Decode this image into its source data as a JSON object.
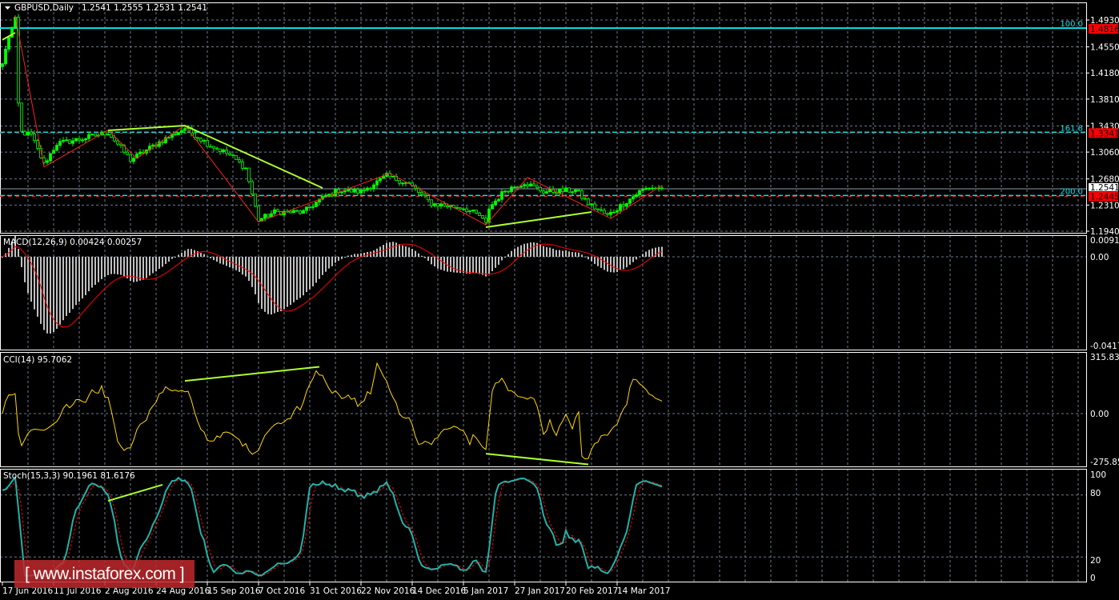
{
  "header": {
    "symbol": "GBPUSD,Daily",
    "ohlc": "1.2541 1.2555 1.2531 1.2541"
  },
  "colors": {
    "bg": "#000000",
    "bull": "#00ff00",
    "fib": "#00e5ee",
    "zigzag": "#ff2020",
    "trend": "#adff2f",
    "macd_hist": "#c0c0c0",
    "signal": "#ff0000",
    "cci": "#ffd700",
    "stoch_main": "#20b2aa",
    "stoch_signal": "#ff0000"
  },
  "watermark": "[ www.instaforex.com ]",
  "chart_data": [
    {
      "type": "candlestick",
      "title": "GBPUSD,Daily",
      "price_axis": {
        "ticks": [
          "1.4930",
          "1.4550",
          "1.4180",
          "1.3810",
          "1.3430",
          "1.3060",
          "1.2680",
          "1.2310",
          "1.1940"
        ],
        "range": [
          1.194,
          1.493
        ]
      },
      "time_axis": [
        "17 Jun 2016",
        "11 Jul 2016",
        "2 Aug 2016",
        "24 Aug 2016",
        "15 Sep 2016",
        "7 Oct 2016",
        "31 Oct 2016",
        "22 Nov 2016",
        "14 Dec 2016",
        "5 Jan 2017",
        "27 Jan 2017",
        "20 Feb 2017",
        "14 Mar 2017"
      ],
      "close_keypoints": [
        [
          0,
          1.431
        ],
        [
          2,
          1.47
        ],
        [
          4,
          1.493
        ],
        [
          5,
          1.374
        ],
        [
          6,
          1.334
        ],
        [
          9,
          1.33
        ],
        [
          13,
          1.289
        ],
        [
          17,
          1.318
        ],
        [
          24,
          1.324
        ],
        [
          33,
          1.334
        ],
        [
          40,
          1.295
        ],
        [
          49,
          1.32
        ],
        [
          57,
          1.34
        ],
        [
          64,
          1.318
        ],
        [
          71,
          1.302
        ],
        [
          76,
          1.283
        ],
        [
          80,
          1.21
        ],
        [
          85,
          1.221
        ],
        [
          94,
          1.221
        ],
        [
          99,
          1.238
        ],
        [
          105,
          1.252
        ],
        [
          112,
          1.25
        ],
        [
          120,
          1.272
        ],
        [
          127,
          1.261
        ],
        [
          134,
          1.233
        ],
        [
          144,
          1.227
        ],
        [
          149,
          1.216
        ],
        [
          151,
          1.204
        ],
        [
          152,
          1.227
        ],
        [
          157,
          1.252
        ],
        [
          163,
          1.263
        ],
        [
          169,
          1.25
        ],
        [
          179,
          1.252
        ],
        [
          183,
          1.233
        ],
        [
          189,
          1.216
        ],
        [
          194,
          1.233
        ],
        [
          199,
          1.25
        ],
        [
          202,
          1.256
        ],
        [
          206,
          1.2541
        ]
      ],
      "fib_levels": [
        {
          "label": "100.0",
          "price": "1.4816"
        },
        {
          "label": "161.8",
          "price": "1.3341"
        },
        {
          "label": "200.0",
          "price": "1.2445"
        }
      ],
      "current_price": "1.2541",
      "zigzag": [
        [
          4,
          1.5
        ],
        [
          13,
          1.285
        ],
        [
          33,
          1.337
        ],
        [
          42,
          1.297
        ],
        [
          57,
          1.344
        ],
        [
          80,
          1.207
        ],
        [
          121,
          1.276
        ],
        [
          151,
          1.203
        ],
        [
          164,
          1.27
        ],
        [
          190,
          1.212
        ],
        [
          206,
          1.259
        ]
      ],
      "trendlines": [
        [
          [
            33,
            1.3367
          ],
          [
            57,
            1.3435
          ]
        ],
        [
          [
            57,
            1.3435
          ],
          [
            100,
            1.2552
          ]
        ],
        [
          [
            151,
            1.1997
          ],
          [
            184,
            1.2212
          ]
        ],
        [
          [
            0,
            1.465
          ],
          [
            4,
            1.475
          ]
        ]
      ]
    },
    {
      "type": "histogram+line",
      "title": "MACD(12,26,9) 0.00424 0.00257",
      "axis": [
        "0.00919",
        "0.00",
        "-0.04175"
      ],
      "range": [
        -0.04175,
        0.00919
      ]
    },
    {
      "type": "line",
      "title": "CCI(14) 95.7062",
      "axis": [
        "315.8312",
        "0.00",
        "-275.855"
      ],
      "range": [
        -275.855,
        315.8312
      ],
      "trendlines": [
        [
          [
            57,
            174.5
          ],
          [
            99,
            249.6
          ]
        ],
        [
          [
            151,
            -214
          ],
          [
            183,
            -271
          ]
        ]
      ]
    },
    {
      "type": "line",
      "title": "Stoch(15,3,3) 90.1961 81.6176",
      "axis": [
        "100",
        "80",
        "20",
        "0"
      ],
      "range": [
        0,
        100
      ],
      "trendlines": [
        [
          [
            33,
            74.4
          ],
          [
            50,
            90
          ]
        ]
      ]
    }
  ]
}
